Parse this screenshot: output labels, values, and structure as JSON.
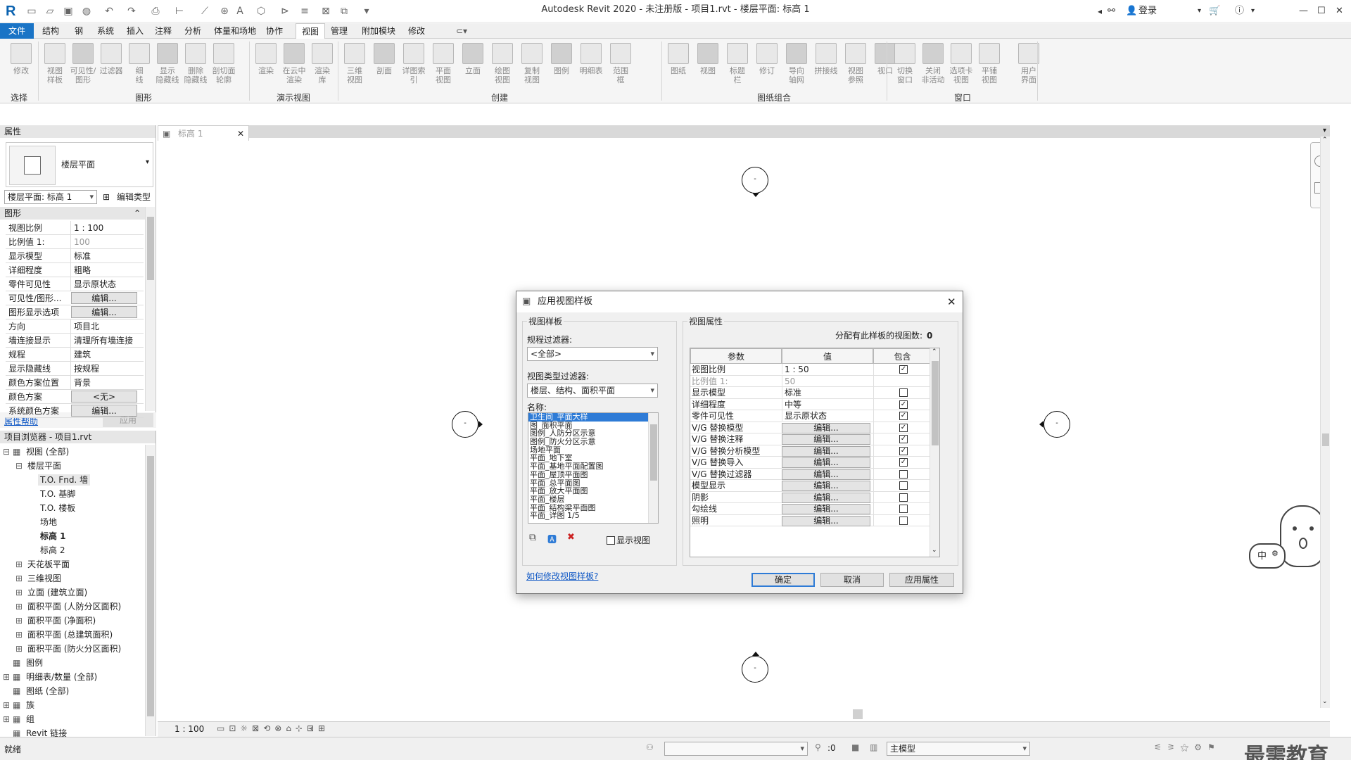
{
  "window": {
    "title": "Autodesk Revit 2020 - 未注册版 - 项目1.rvt - 楼层平面: 标高 1",
    "login": "登录"
  },
  "ribbon_tabs": [
    "文件",
    "结构",
    "钢",
    "系统",
    "插入",
    "注释",
    "分析",
    "体量和场地",
    "协作",
    "视图",
    "管理",
    "附加模块",
    "修改"
  ],
  "active_tab": "视图",
  "ribbon_buttons": {
    "select": [
      "修改"
    ],
    "graphics": [
      "视图\n样板",
      "可见性/\n图形",
      "过滤器",
      "细\n线",
      "显示\n隐藏线",
      "删除\n隐藏线",
      "剖切面\n轮廓"
    ],
    "presentation": [
      "渲染",
      "在云中\n渲染",
      "渲染\n库"
    ],
    "create": [
      "三维\n视图",
      "剖面",
      "详图索引",
      "平面\n视图",
      "立面",
      "绘图\n视图",
      "复制\n视图",
      "图例",
      "明细表",
      "范围\n框"
    ],
    "sheet": [
      "图纸",
      "视图",
      "标题\n栏",
      "修订",
      "导向\n轴网",
      "拼接线",
      "视图\n参照",
      "视口"
    ],
    "window": [
      "切换\n窗口",
      "关闭\n非活动",
      "选项卡\n视图",
      "平铺\n视图"
    ],
    "ui": [
      "用户\n界面"
    ]
  },
  "ribbon_groups": [
    "选择",
    "图形",
    "演示视图",
    "创建",
    "图纸组合",
    "窗口"
  ],
  "properties": {
    "header": "属性",
    "type_name": "楼层平面",
    "instance_select": "楼层平面: 标高 1",
    "edit_type": "编辑类型",
    "section": "图形",
    "rows": [
      {
        "k": "视图比例",
        "v": "1 : 100",
        "btn": false,
        "gray": false
      },
      {
        "k": "比例值 1:",
        "v": "100",
        "btn": false,
        "gray": true
      },
      {
        "k": "显示模型",
        "v": "标准",
        "btn": false,
        "gray": false
      },
      {
        "k": "详细程度",
        "v": "粗略",
        "btn": false,
        "gray": false
      },
      {
        "k": "零件可见性",
        "v": "显示原状态",
        "btn": false,
        "gray": false
      },
      {
        "k": "可见性/图形...",
        "v": "编辑...",
        "btn": true,
        "gray": false
      },
      {
        "k": "图形显示选项",
        "v": "编辑...",
        "btn": true,
        "gray": false
      },
      {
        "k": "方向",
        "v": "项目北",
        "btn": false,
        "gray": false
      },
      {
        "k": "墙连接显示",
        "v": "清理所有墙连接",
        "btn": false,
        "gray": false
      },
      {
        "k": "规程",
        "v": "建筑",
        "btn": false,
        "gray": false
      },
      {
        "k": "显示隐藏线",
        "v": "按规程",
        "btn": false,
        "gray": false
      },
      {
        "k": "颜色方案位置",
        "v": "背景",
        "btn": false,
        "gray": false
      },
      {
        "k": "颜色方案",
        "v": "<无>",
        "btn": true,
        "gray": false
      },
      {
        "k": "系统颜色方案",
        "v": "编辑...",
        "btn": true,
        "gray": false
      }
    ],
    "help": "属性帮助",
    "apply": "应用"
  },
  "browser": {
    "header": "项目浏览器 - 项目1.rvt",
    "items": [
      {
        "t": "视图 (全部)",
        "lvl": 0,
        "exp": "⊟",
        "bold": false,
        "sel": false
      },
      {
        "t": "楼层平面",
        "lvl": 1,
        "exp": "⊟",
        "bold": false,
        "sel": false
      },
      {
        "t": "T.O. Fnd. 墙",
        "lvl": 2,
        "exp": "",
        "bold": false,
        "sel": true
      },
      {
        "t": "T.O. 基脚",
        "lvl": 2,
        "exp": "",
        "bold": false,
        "sel": false
      },
      {
        "t": "T.O. 楼板",
        "lvl": 2,
        "exp": "",
        "bold": false,
        "sel": false
      },
      {
        "t": "场地",
        "lvl": 2,
        "exp": "",
        "bold": false,
        "sel": false
      },
      {
        "t": "标高 1",
        "lvl": 2,
        "exp": "",
        "bold": true,
        "sel": false
      },
      {
        "t": "标高 2",
        "lvl": 2,
        "exp": "",
        "bold": false,
        "sel": false
      },
      {
        "t": "天花板平面",
        "lvl": 1,
        "exp": "⊞",
        "bold": false,
        "sel": false
      },
      {
        "t": "三维视图",
        "lvl": 1,
        "exp": "⊞",
        "bold": false,
        "sel": false
      },
      {
        "t": "立面 (建筑立面)",
        "lvl": 1,
        "exp": "⊞",
        "bold": false,
        "sel": false
      },
      {
        "t": "面积平面 (人防分区面积)",
        "lvl": 1,
        "exp": "⊞",
        "bold": false,
        "sel": false
      },
      {
        "t": "面积平面 (净面积)",
        "lvl": 1,
        "exp": "⊞",
        "bold": false,
        "sel": false
      },
      {
        "t": "面积平面 (总建筑面积)",
        "lvl": 1,
        "exp": "⊞",
        "bold": false,
        "sel": false
      },
      {
        "t": "面积平面 (防火分区面积)",
        "lvl": 1,
        "exp": "⊞",
        "bold": false,
        "sel": false
      },
      {
        "t": "图例",
        "lvl": 0,
        "exp": "",
        "bold": false,
        "sel": false
      },
      {
        "t": "明细表/数量 (全部)",
        "lvl": 0,
        "exp": "⊞",
        "bold": false,
        "sel": false
      },
      {
        "t": "图纸 (全部)",
        "lvl": 0,
        "exp": "",
        "bold": false,
        "sel": false
      },
      {
        "t": "族",
        "lvl": 0,
        "exp": "⊞",
        "bold": false,
        "sel": false
      },
      {
        "t": "组",
        "lvl": 0,
        "exp": "⊞",
        "bold": false,
        "sel": false
      },
      {
        "t": "Revit 链接",
        "lvl": 0,
        "exp": "",
        "bold": false,
        "sel": false
      }
    ]
  },
  "doc_tab": "标高 1",
  "view_scale": "1 : 100",
  "status": {
    "left": "就绪",
    "coord": ":0",
    "model": "主模型"
  },
  "watermark": "最需教育",
  "dialog": {
    "title": "应用视图样板",
    "left_group": "视图样板",
    "discipline_filter_label": "规程过滤器:",
    "discipline_filter": "<全部>",
    "viewtype_filter_label": "视图类型过滤器:",
    "viewtype_filter": "楼层、结构、面积平面",
    "names_label": "名称:",
    "names": [
      "卫生间_平面大样",
      "图_面积平面",
      "图例_人防分区示意",
      "图例_防火分区示意",
      "场地平面",
      "平面_地下室",
      "平面_基地平面配置图",
      "平面_屋顶平面图",
      "平面_总平面图",
      "平面_放大平面图",
      "平面_楼层",
      "平面_结构梁平面图",
      "平面_详图  1/5"
    ],
    "show_views": "显示视图",
    "help_link": "如何修改视图样板?",
    "right_group": "视图属性",
    "assigned_label": "分配有此样板的视图数:",
    "assigned_count": "0",
    "col_param": "参数",
    "col_value": "值",
    "col_include": "包含",
    "rows": [
      {
        "p": "视图比例",
        "v": "1 : 50",
        "btn": false,
        "gray": false,
        "chk": true,
        "cb": true
      },
      {
        "p": "比例值 1:",
        "v": "50",
        "btn": false,
        "gray": true,
        "chk": false,
        "cb": false
      },
      {
        "p": "显示模型",
        "v": "标准",
        "btn": false,
        "gray": false,
        "chk": false,
        "cb": true
      },
      {
        "p": "详细程度",
        "v": "中等",
        "btn": false,
        "gray": false,
        "chk": true,
        "cb": true
      },
      {
        "p": "零件可见性",
        "v": "显示原状态",
        "btn": false,
        "gray": false,
        "chk": true,
        "cb": true
      },
      {
        "p": "V/G 替换模型",
        "v": "编辑...",
        "btn": true,
        "gray": false,
        "chk": true,
        "cb": true
      },
      {
        "p": "V/G 替换注释",
        "v": "编辑...",
        "btn": true,
        "gray": false,
        "chk": true,
        "cb": true
      },
      {
        "p": "V/G 替换分析模型",
        "v": "编辑...",
        "btn": true,
        "gray": false,
        "chk": true,
        "cb": true
      },
      {
        "p": "V/G 替换导入",
        "v": "编辑...",
        "btn": true,
        "gray": false,
        "chk": true,
        "cb": true
      },
      {
        "p": "V/G 替换过滤器",
        "v": "编辑...",
        "btn": true,
        "gray": false,
        "chk": false,
        "cb": true
      },
      {
        "p": "模型显示",
        "v": "编辑...",
        "btn": true,
        "gray": false,
        "chk": false,
        "cb": true
      },
      {
        "p": "阴影",
        "v": "编辑...",
        "btn": true,
        "gray": false,
        "chk": false,
        "cb": true
      },
      {
        "p": "勾绘线",
        "v": "编辑...",
        "btn": true,
        "gray": false,
        "chk": false,
        "cb": true
      },
      {
        "p": "照明",
        "v": "编辑...",
        "btn": true,
        "gray": false,
        "chk": false,
        "cb": true
      }
    ],
    "ok": "确定",
    "cancel": "取消",
    "apply_props": "应用属性"
  }
}
